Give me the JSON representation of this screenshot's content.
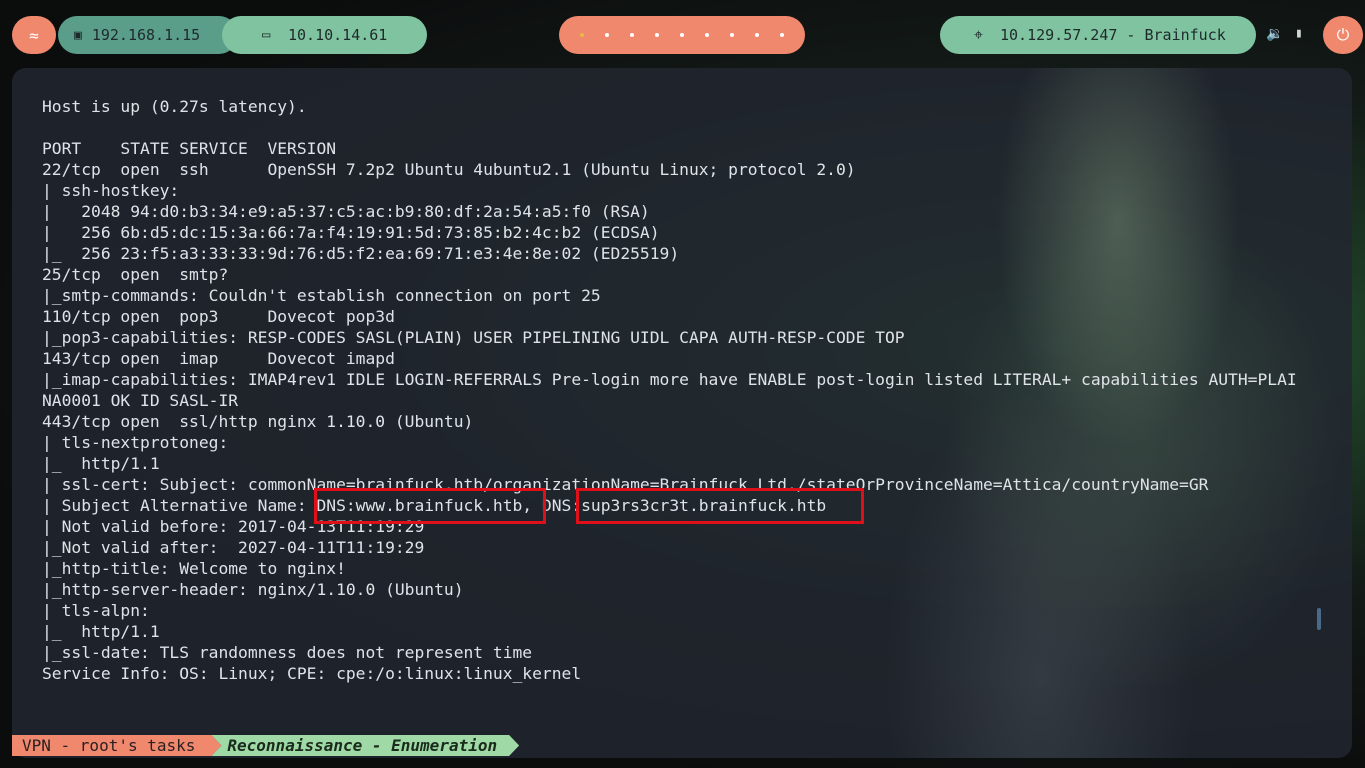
{
  "topbar": {
    "menu_icon": "swirl-icon",
    "lan_ip": "192.168.1.15",
    "vpn_ip": "10.10.14.61",
    "target": "10.129.57.247 - Brainfuck",
    "workspaces_count": 9,
    "active_workspace": 1
  },
  "terminal": {
    "lines": [
      "Host is up (0.27s latency).",
      "",
      "PORT    STATE SERVICE  VERSION",
      "22/tcp  open  ssh      OpenSSH 7.2p2 Ubuntu 4ubuntu2.1 (Ubuntu Linux; protocol 2.0)",
      "| ssh-hostkey:",
      "|   2048 94:d0:b3:34:e9:a5:37:c5:ac:b9:80:df:2a:54:a5:f0 (RSA)",
      "|   256 6b:d5:dc:15:3a:66:7a:f4:19:91:5d:73:85:b2:4c:b2 (ECDSA)",
      "|_  256 23:f5:a3:33:33:9d:76:d5:f2:ea:69:71:e3:4e:8e:02 (ED25519)",
      "25/tcp  open  smtp?",
      "|_smtp-commands: Couldn't establish connection on port 25",
      "110/tcp open  pop3     Dovecot pop3d",
      "|_pop3-capabilities: RESP-CODES SASL(PLAIN) USER PIPELINING UIDL CAPA AUTH-RESP-CODE TOP",
      "143/tcp open  imap     Dovecot imapd",
      "|_imap-capabilities: IMAP4rev1 IDLE LOGIN-REFERRALS Pre-login more have ENABLE post-login listed LITERAL+ capabilities AUTH=PLAI",
      "NA0001 OK ID SASL-IR",
      "443/tcp open  ssl/http nginx 1.10.0 (Ubuntu)",
      "| tls-nextprotoneg:",
      "|_  http/1.1",
      "| ssl-cert: Subject: commonName=brainfuck.htb/organizationName=Brainfuck Ltd./stateOrProvinceName=Attica/countryName=GR",
      "| Subject Alternative Name: DNS:www.brainfuck.htb, DNS:sup3rs3cr3t.brainfuck.htb",
      "| Not valid before: 2017-04-13T11:19:29",
      "|_Not valid after:  2027-04-11T11:19:29",
      "|_http-title: Welcome to nginx!",
      "|_http-server-header: nginx/1.10.0 (Ubuntu)",
      "| tls-alpn:",
      "|_  http/1.1",
      "|_ssl-date: TLS randomness does not represent time",
      "Service Info: OS: Linux; CPE: cpe:/o:linux:linux_kernel"
    ],
    "highlights": [
      "DNS:www.brainfuck.htb",
      "DNS:sup3rs3cr3t.brainfuck.htb"
    ],
    "highlight_color": "#e0101a"
  },
  "status": {
    "session": "VPN - root's tasks",
    "window": "Reconnaissance - Enumeration"
  },
  "colors": {
    "accent_salmon": "#f0886e",
    "accent_green": "#7fc3a0",
    "accent_teal": "#5a9e8a"
  }
}
